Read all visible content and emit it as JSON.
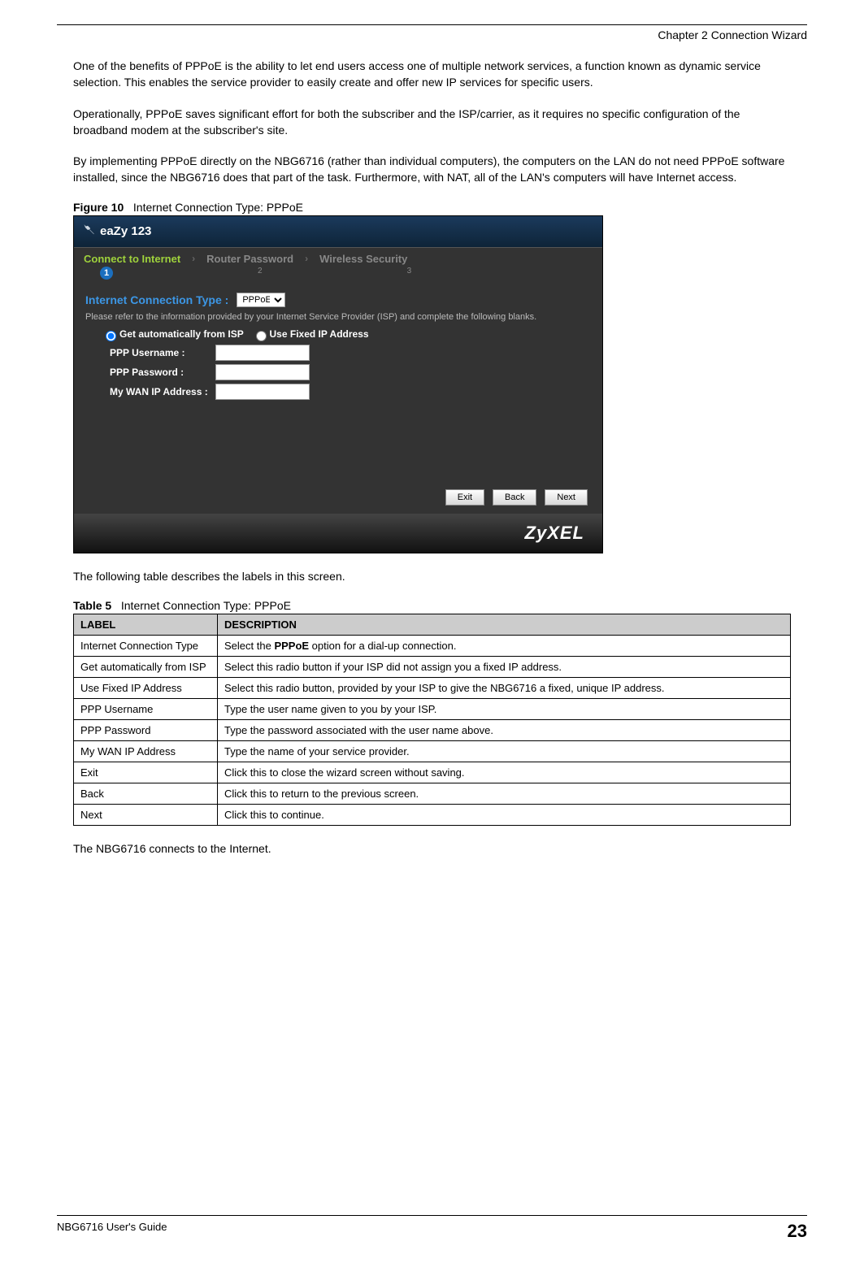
{
  "header": {
    "chapter": "Chapter 2 Connection Wizard"
  },
  "paragraphs": {
    "p1": "One of the benefits of PPPoE is the ability to let end users access one of multiple network services, a function known as dynamic service selection. This enables the service provider to easily create and offer new IP services for specific users.",
    "p2": "Operationally, PPPoE saves significant effort for both the subscriber and the ISP/carrier, as it requires no specific configuration of the broadband modem at the subscriber's site.",
    "p3": "By implementing PPPoE directly on the NBG6716 (rather than individual computers), the computers on the LAN do not need PPPoE software installed, since the NBG6716 does that part of the task. Furthermore, with NAT, all of the LAN's computers will have Internet access.",
    "p_after_fig": "The following table describes the labels in this screen.",
    "p_end": "The NBG6716 connects to the Internet."
  },
  "figure": {
    "num": "Figure 10",
    "title": "Internet Connection Type: PPPoE"
  },
  "ui": {
    "title": "eaZy 123",
    "steps": {
      "s1": "Connect to Internet",
      "s2": "Router Password",
      "s3": "Wireless Security",
      "n1": "1",
      "n2": "2",
      "n3": "3"
    },
    "conn_label": "Internet Connection Type :",
    "conn_value": "PPPoE",
    "hint": "Please refer to the information provided by your Internet Service Provider (ISP) and complete the following blanks.",
    "radio_auto": "Get automatically from ISP",
    "radio_fixed": "Use Fixed IP Address",
    "ppp_user": "PPP Username :",
    "ppp_pass": "PPP Password :",
    "wan_ip": "My WAN IP Address :",
    "btn_exit": "Exit",
    "btn_back": "Back",
    "btn_next": "Next",
    "brand": "ZyXEL"
  },
  "table": {
    "num": "Table 5",
    "title": "Internet Connection Type: PPPoE",
    "col_label": "LABEL",
    "col_desc": "DESCRIPTION",
    "rows": [
      {
        "label": "Internet Connection Type",
        "desc_pre": "Select the ",
        "desc_bold": "PPPoE",
        "desc_post": " option for a dial-up connection."
      },
      {
        "label": "Get automatically from ISP",
        "desc": "Select this radio button if your ISP did not assign you a fixed IP address."
      },
      {
        "label": "Use Fixed IP Address",
        "desc": "Select this radio button, provided by your ISP to give the NBG6716 a fixed, unique IP address."
      },
      {
        "label": "PPP Username",
        "desc": "Type the user name given to you by your ISP."
      },
      {
        "label": "PPP Password",
        "desc": "Type the password associated with the user name above."
      },
      {
        "label": "My WAN IP Address",
        "desc": "Type the name of your service provider."
      },
      {
        "label": "Exit",
        "desc": "Click this to close the wizard screen without saving."
      },
      {
        "label": "Back",
        "desc": "Click this to return to the previous screen."
      },
      {
        "label": "Next",
        "desc": "Click this to continue."
      }
    ]
  },
  "footer": {
    "guide": "NBG6716 User's Guide",
    "page": "23"
  }
}
